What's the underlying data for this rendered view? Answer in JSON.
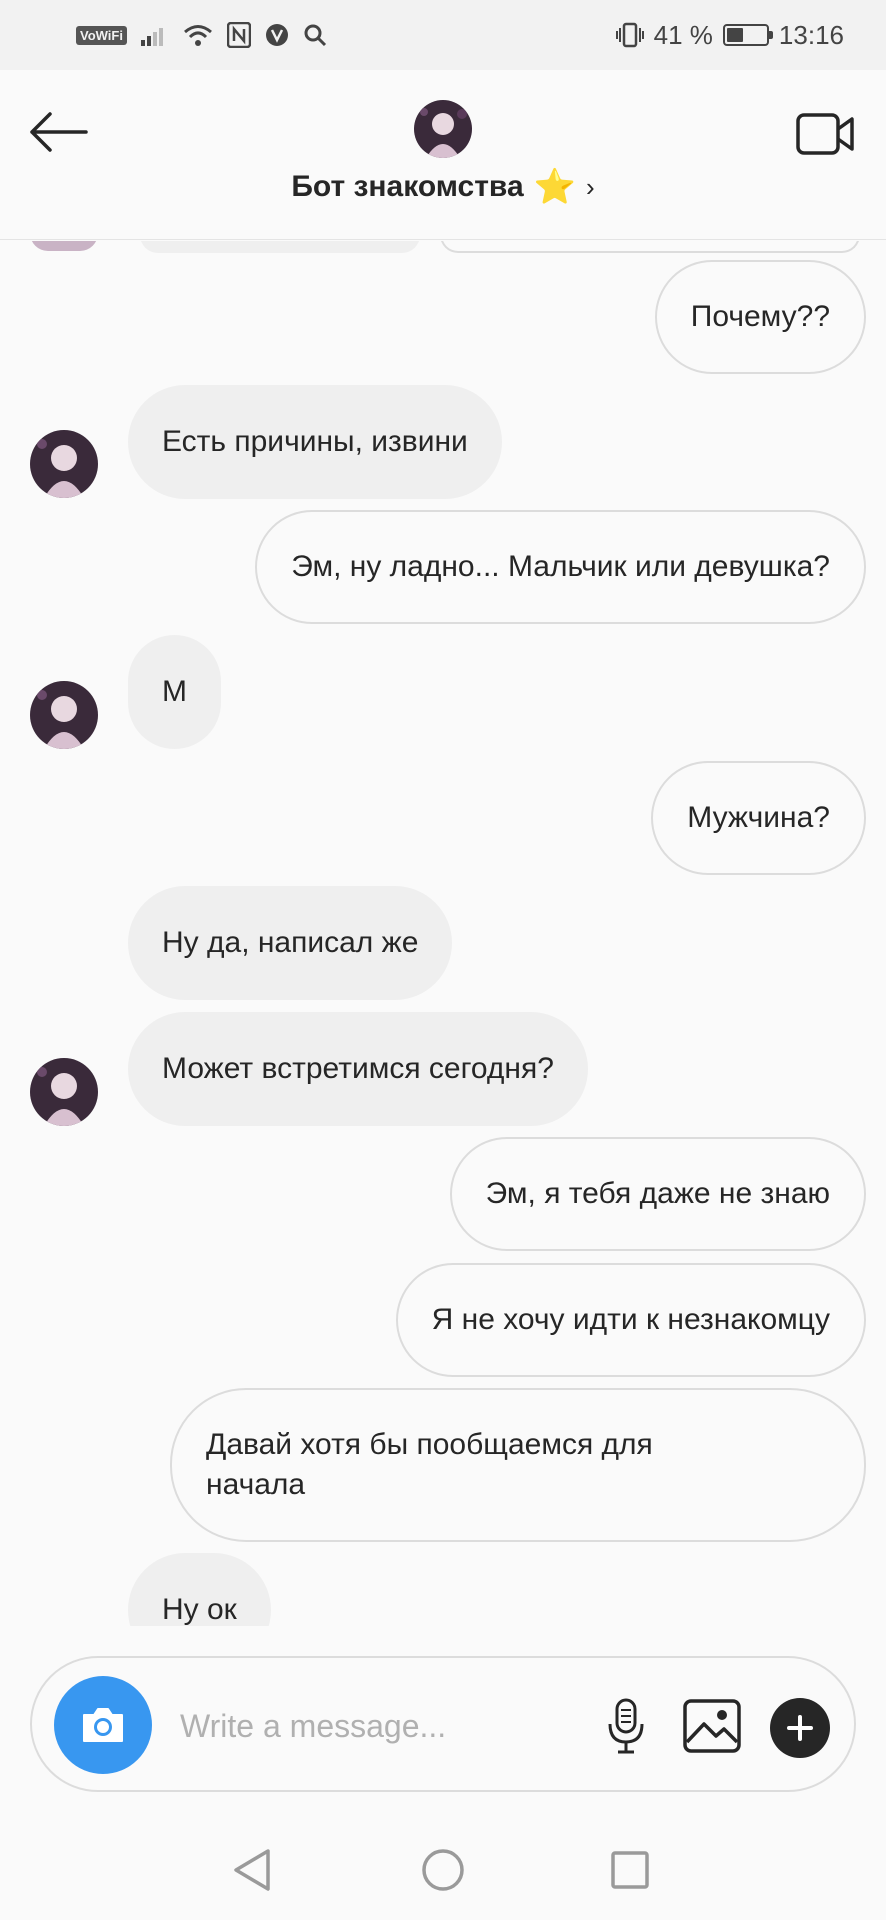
{
  "status_bar": {
    "vowifi": "VoWiFi",
    "battery_percent": "41 %",
    "battery_level": 0.41,
    "time": "13:16"
  },
  "header": {
    "title": "Бот знакомства",
    "title_emoji": "⭐",
    "chevron": "›"
  },
  "messages": [
    {
      "side": "out",
      "text": "Почему??"
    },
    {
      "side": "in",
      "text": "Есть причины, извини",
      "avatar": true
    },
    {
      "side": "out",
      "text": "Эм, ну ладно... Мальчик или девушка?"
    },
    {
      "side": "in",
      "text": "М",
      "avatar": true
    },
    {
      "side": "out",
      "text": "Мужчина?"
    },
    {
      "side": "in",
      "text": "Ну да, написал же"
    },
    {
      "side": "in",
      "text": "Может встретимся сегодня?",
      "avatar": true
    },
    {
      "side": "out",
      "text": "Эм, я тебя даже не знаю"
    },
    {
      "side": "out",
      "text": "Я не хочу идти к незнакомцу"
    },
    {
      "side": "out",
      "text": "Давай хотя бы пообщаемся для начала"
    },
    {
      "side": "in",
      "text": "Ну ок"
    }
  ],
  "composer": {
    "placeholder": "Write a message..."
  },
  "icons": {
    "back": "arrow-left-icon",
    "video": "video-camera-icon",
    "camera": "camera-icon",
    "mic": "microphone-icon",
    "gallery": "image-icon",
    "plus": "plus-icon"
  },
  "colors": {
    "accent": "#3897f0",
    "incoming_bubble": "#efefef",
    "outgoing_border": "#dcdcdc",
    "star": "#f5c518"
  }
}
